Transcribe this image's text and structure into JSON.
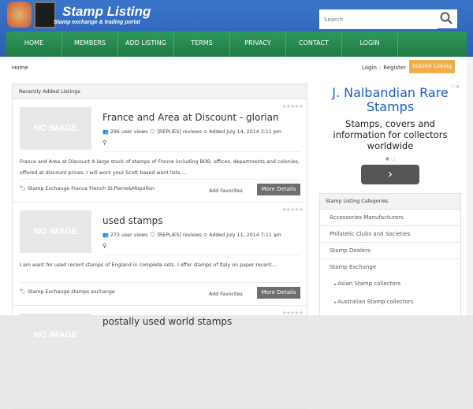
{
  "header": {
    "title": "Stamp Listing",
    "subtitle": "Stamp exchange & trading portal",
    "search_placeholder": "Search"
  },
  "nav": [
    "HOME",
    "MEMBERS",
    "ADD LISTING",
    "TERMS",
    "PRIVACY",
    "CONTACT",
    "LOGIN"
  ],
  "breadcrumb": "Home",
  "auth": {
    "login": "Login",
    "sep": "/",
    "register": "Register",
    "submit": "Submit Listing"
  },
  "listings_panel": {
    "title": "Recently Added Listings",
    "listings": [
      {
        "image": "NO IMAGE",
        "title": "France and Area at Discount - glorian",
        "meta": "296 user views 🗨 [REPLIES] reviews ⊙ Added July 14, 2014 3:11 pm",
        "description": "France and Area at Discount A large stock of stamps of Frsnce including BOB, offices, departments and colonies, offered at discount prices. I will work your Scott based want lists....",
        "tags": "Stamp Exchange France French St.Pierre&Miquillon",
        "fav": "Add Favorites",
        "more": "More Details"
      },
      {
        "image": "NO IMAGE",
        "title": "used stamps",
        "meta": "273 user views 🗨 [REPLIES] reviews ⊙ Added July 11, 2014 7:11 am",
        "description": "I am want for used recent stamps of England in complete sets. I offer stamps of Italy on paper recent....",
        "tags": "Stamp Exchange stamps exchange",
        "fav": "Add Favorites",
        "more": "More Details"
      },
      {
        "image": "NO IMAGE",
        "title": "postally used world stamps"
      }
    ]
  },
  "ad": {
    "title": "J. Nalbandian Rare Stamps",
    "text": "Stamps, covers and information for collectors worldwide",
    "arrow": "›"
  },
  "categories": {
    "title": "Stamp Listing Categories",
    "items": [
      "Accessories Manufacturers",
      "Philatelic Clubs and Societies",
      "Stamp Dealers",
      "Stamp Exchange"
    ],
    "subitems": [
      "Asian Stamp collectors",
      "Australian Stamp collectors"
    ]
  }
}
